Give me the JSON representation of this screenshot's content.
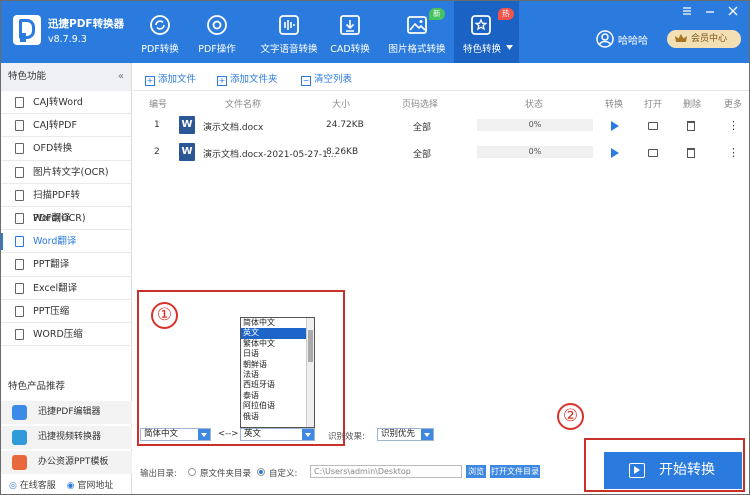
{
  "app": {
    "title": "迅捷PDF转换器",
    "version": "v8.7.9.3"
  },
  "nav": [
    {
      "label": "PDF转换",
      "icon": "refresh-icon"
    },
    {
      "label": "PDF操作",
      "icon": "settings-circle-icon"
    },
    {
      "label": "文字语音转换",
      "icon": "audio-wave-icon"
    },
    {
      "label": "CAD转换",
      "icon": "download-box-icon"
    },
    {
      "label": "图片格式转换",
      "icon": "image-icon",
      "badge": "新"
    },
    {
      "label": "特色转换",
      "icon": "star-refresh-icon",
      "badge": "热"
    }
  ],
  "user": {
    "name": "哈哈哈",
    "member": "会员中心"
  },
  "sidebar": {
    "title": "特色功能",
    "items": [
      "CAJ转Word",
      "CAJ转PDF",
      "OFD转换",
      "图片转文字(OCR)",
      "扫描PDF转Word(OCR)",
      "PDF翻译",
      "Word翻译",
      "PPT翻译",
      "Excel翻译",
      "PPT压缩",
      "WORD压缩"
    ],
    "recommend_title": "特色产品推荐",
    "recommend": [
      "迅捷PDF编辑器",
      "迅捷视频转换器",
      "办公资源PPT模板"
    ],
    "footer": [
      "在线客服",
      "官网地址"
    ]
  },
  "toolbar": {
    "add_file": "添加文件",
    "add_folder": "添加文件夹",
    "clear_list": "清空列表"
  },
  "table": {
    "headers": [
      "编号",
      "文件名称",
      "大小",
      "页码选择",
      "状态",
      "转换",
      "打开",
      "删除",
      "更多"
    ],
    "rows": [
      {
        "num": "1",
        "name": "演示文档.docx",
        "size": "24.72KB",
        "pages": "全部",
        "status": "0%",
        "more": "⋮"
      },
      {
        "num": "2",
        "name": "演示文档.docx-2021-05-27-1...",
        "size": "8.26KB",
        "pages": "全部",
        "status": "0%",
        "more": "⋮"
      }
    ]
  },
  "annotations": {
    "one": "①",
    "two": "②"
  },
  "translate": {
    "languages": [
      "简体中文",
      "英文",
      "繁体中文",
      "日语",
      "朝鲜语",
      "法语",
      "西班牙语",
      "泰语",
      "阿拉伯语",
      "俄语"
    ],
    "source": "简体中文",
    "arrow": "<-->",
    "target": "英文",
    "mode_label": "识别效果:",
    "mode": "识别优先"
  },
  "output": {
    "label": "输出目录:",
    "option_source": "原文件夹目录",
    "option_custom": "自定义:",
    "path": "C:\\Users\\admin\\Desktop",
    "browse": "浏览",
    "open_dir": "打开文件目录"
  },
  "start_button": "开始转换"
}
